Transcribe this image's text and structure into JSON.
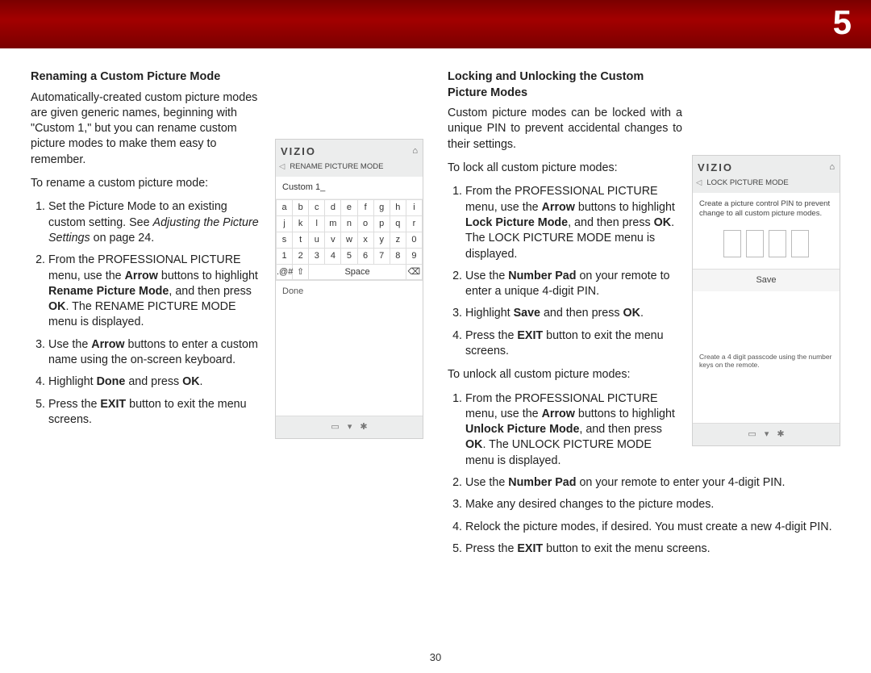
{
  "chapter": "5",
  "page_number": "30",
  "left": {
    "heading": "Renaming a Custom Picture Mode",
    "intro": "Automatically-created custom picture modes are given generic names, beginning with \"Custom 1,\" but you can rename custom picture modes to make them easy to remember.",
    "lead": "To rename a custom picture mode:",
    "steps": {
      "s1a": "Set the Picture Mode to an existing custom setting. See ",
      "s1i": "Adjusting the Picture Settings",
      "s1b": " on page 24.",
      "s2a": "From the PROFESSIONAL PICTURE menu, use the ",
      "s2b1": "Arrow",
      "s2c": " buttons to highlight ",
      "s2b2": "Rename Picture Mode",
      "s2d": ", and then press ",
      "s2b3": "OK",
      "s2e": ". The RENAME PICTURE MODE menu is displayed.",
      "s3a": "Use the ",
      "s3b": "Arrow",
      "s3c": " buttons to enter a custom name using the on-screen keyboard.",
      "s4a": "Highlight ",
      "s4b1": "Done",
      "s4c": " and press ",
      "s4b2": "OK",
      "s4d": ".",
      "s5a": "Press the ",
      "s5b": "EXIT",
      "s5c": " button to exit the menu screens."
    }
  },
  "right": {
    "heading": "Locking and Unlocking the Custom Picture Modes",
    "intro": "Custom picture modes can be locked with a unique PIN to prevent accidental changes to their settings.",
    "lead_lock": "To lock all custom picture modes:",
    "lock_steps": {
      "l1a": "From the PROFESSIONAL PICTURE menu, use the ",
      "l1b1": "Arrow",
      "l1c": " buttons to highlight ",
      "l1b2": "Lock Picture Mode",
      "l1d": ", and then press ",
      "l1b3": "OK",
      "l1e": ". The LOCK PICTURE MODE menu is displayed.",
      "l2a": "Use the ",
      "l2b": "Number Pad",
      "l2c": " on your remote to enter a unique 4-digit PIN.",
      "l3a": "Highlight ",
      "l3b": "Save",
      "l3c": " and then press ",
      "l3d": "OK",
      "l3e": ".",
      "l4a": "Press the ",
      "l4b": "EXIT",
      "l4c": " button to exit the menu screens."
    },
    "lead_unlock": "To unlock all custom picture modes:",
    "unlock_steps": {
      "u1a": "From the PROFESSIONAL PICTURE menu, use the ",
      "u1b1": "Arrow",
      "u1c": " buttons to highlight ",
      "u1b2": "Unlock Picture Mode",
      "u1d": ", and then press ",
      "u1b3": "OK",
      "u1e": ". The UNLOCK PICTURE MODE menu is displayed.",
      "u2a": "Use the ",
      "u2b": "Number Pad",
      "u2c": " on your remote to enter your 4-digit PIN.",
      "u3": "Make any desired changes to the picture modes.",
      "u4": "Relock the picture modes, if desired. You must create a new 4-digit PIN.",
      "u5a": "Press the ",
      "u5b": "EXIT",
      "u5c": " button to exit the menu screens."
    }
  },
  "panel_rename": {
    "logo": "VIZIO",
    "title": "RENAME PICTURE MODE",
    "field": "Custom 1_",
    "keys": {
      "r1": [
        "a",
        "b",
        "c",
        "d",
        "e",
        "f",
        "g",
        "h",
        "i"
      ],
      "r2": [
        "j",
        "k",
        "l",
        "m",
        "n",
        "o",
        "p",
        "q",
        "r"
      ],
      "r3": [
        "s",
        "t",
        "u",
        "v",
        "w",
        "x",
        "y",
        "z",
        "0"
      ],
      "r4": [
        "1",
        "2",
        "3",
        "4",
        "5",
        "6",
        "7",
        "8",
        "9"
      ],
      "ctrl_sym": ".@#",
      "ctrl_shift": "⇧",
      "ctrl_space": "Space",
      "ctrl_back": "⌫"
    },
    "done": "Done"
  },
  "panel_lock": {
    "logo": "VIZIO",
    "title": "LOCK PICTURE MODE",
    "desc": "Create a picture control PIN to prevent change to all custom picture modes.",
    "save": "Save",
    "foot": "Create a 4 digit passcode using the number keys on the remote."
  },
  "footicons": {
    "a": "▭",
    "b": "▾",
    "c": "✱"
  }
}
